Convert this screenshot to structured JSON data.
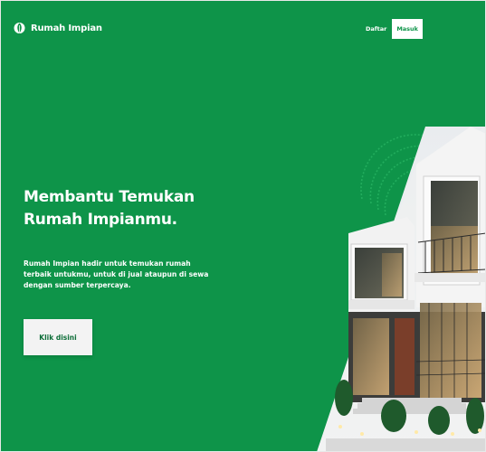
{
  "header": {
    "brand_name": "Rumah Impian",
    "nav": {
      "register_label": "Daftar",
      "login_label": "Masuk"
    }
  },
  "hero": {
    "headline_line1": "Membantu Temukan",
    "headline_line2": "Rumah Impianmu.",
    "description": "Rumah Impian hadir untuk temukan rumah terbaik untukmu, untuk di jual ataupun di sewa dengan sumber terpercaya.",
    "cta_label": "Klik disini"
  },
  "icons": {
    "logo": "leaf-logo-icon",
    "hero_image": "modern-house-image"
  },
  "colors": {
    "brand_green": "#0e9449",
    "button_bg": "#f3f3f3",
    "text_white": "#ffffff"
  }
}
